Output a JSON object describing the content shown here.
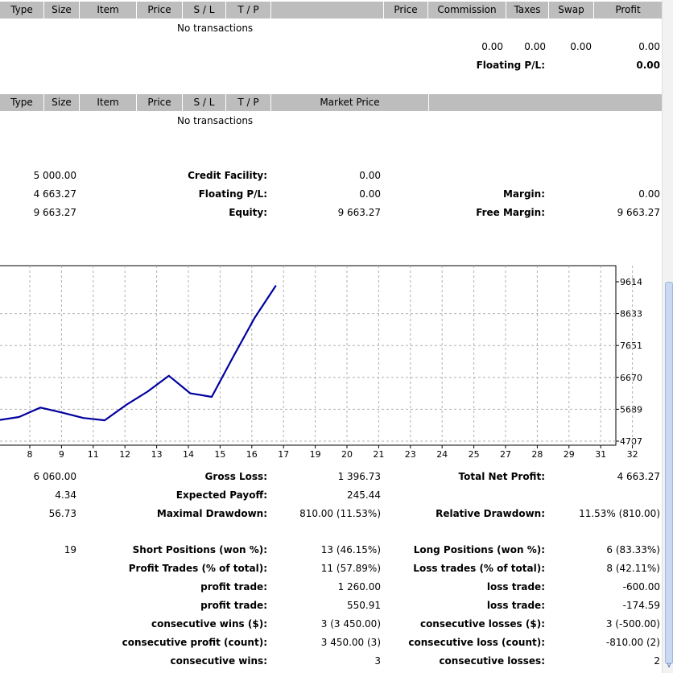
{
  "trades_header": {
    "columns": [
      "Type",
      "Size",
      "Item",
      "Price",
      "S / L",
      "T / P",
      "Price",
      "Commission",
      "Taxes",
      "Swap",
      "Profit"
    ]
  },
  "trades": {
    "empty_text": "No transactions",
    "total_commission": "0.00",
    "total_taxes": "0.00",
    "total_swap": "0.00",
    "total_profit": "0.00",
    "floating_label": "Floating P/L:",
    "floating_value": "0.00"
  },
  "orders_header": {
    "columns": [
      "Type",
      "Size",
      "Item",
      "Price",
      "S / L",
      "T / P",
      "Market Price"
    ]
  },
  "orders": {
    "empty_text": "No transactions"
  },
  "account": {
    "deposit": "5 000.00",
    "closed_pl": "4 663.27",
    "balance": "9 663.27",
    "credit_label": "Credit Facility:",
    "credit_value": "0.00",
    "floating_label": "Floating P/L:",
    "floating_value": "0.00",
    "equity_label": "Equity:",
    "equity_value": "9 663.27",
    "margin_label": "Margin:",
    "margin_value": "0.00",
    "free_margin_label": "Free Margin:",
    "free_margin_value": "9 663.27"
  },
  "chart_data": {
    "type": "line",
    "x": [
      6,
      7,
      8,
      9,
      10,
      11,
      12,
      13,
      14,
      15,
      16,
      17,
      18,
      19
    ],
    "series": [
      {
        "values": [
          5350,
          5450,
          5740,
          5590,
          5420,
          5350,
          5820,
          6230,
          6720,
          6180,
          6070,
          7300,
          8500,
          9500
        ]
      }
    ],
    "x_ticks": [
      "8",
      "9",
      "11",
      "12",
      "13",
      "14",
      "15",
      "16",
      "17",
      "19",
      "20",
      "21",
      "23",
      "24",
      "25",
      "27",
      "28",
      "29",
      "31",
      "32"
    ],
    "y_ticks": [
      "9614",
      "8633",
      "7651",
      "6670",
      "5689",
      "4707"
    ],
    "ylim": [
      4707,
      9614
    ],
    "grid": true,
    "line_color": "#0000a0"
  },
  "stats": {
    "gross_profit": "6 060.00",
    "gross_loss_label": "Gross Loss:",
    "gross_loss": "1 396.73",
    "total_net_profit_label": "Total Net Profit:",
    "total_net_profit": "4 663.27",
    "profit_factor": "4.34",
    "expected_payoff_label": "Expected Payoff:",
    "expected_payoff": "245.44",
    "abs_drawdown": "56.73",
    "maximal_drawdown_label": "Maximal Drawdown:",
    "maximal_drawdown": "810.00 (11.53%)",
    "relative_drawdown_label": "Relative Drawdown:",
    "relative_drawdown": "11.53% (810.00)",
    "total_trades": "19",
    "short_label": "Short Positions (won %):",
    "short_value": "13 (46.15%)",
    "long_label": "Long Positions (won %):",
    "long_value": "6 (83.33%)",
    "profit_trades_label": "Profit Trades (% of total):",
    "profit_trades_value": "11 (57.89%)",
    "loss_trades_label": "Loss trades (% of total):",
    "loss_trades_value": "8 (42.11%)",
    "largest_profit_label": "profit trade:",
    "largest_profit_value": "1 260.00",
    "largest_loss_label": "loss trade:",
    "largest_loss_value": "-600.00",
    "average_profit_label": "profit trade:",
    "average_profit_value": "550.91",
    "average_loss_label": "loss trade:",
    "average_loss_value": "-174.59",
    "max_cons_wins_label": "consecutive wins ($):",
    "max_cons_wins_value": "3 (3 450.00)",
    "max_cons_losses_label": "consecutive losses ($):",
    "max_cons_losses_value": "3 (-500.00)",
    "max_cons_profit_label": "consecutive profit (count):",
    "max_cons_profit_value": "3 450.00 (3)",
    "max_cons_loss_label": "consecutive loss (count):",
    "max_cons_loss_value": "-810.00 (2)",
    "avg_cons_wins_label": "consecutive wins:",
    "avg_cons_wins_value": "3",
    "avg_cons_losses_label": "consecutive losses:",
    "avg_cons_losses_value": "2"
  }
}
